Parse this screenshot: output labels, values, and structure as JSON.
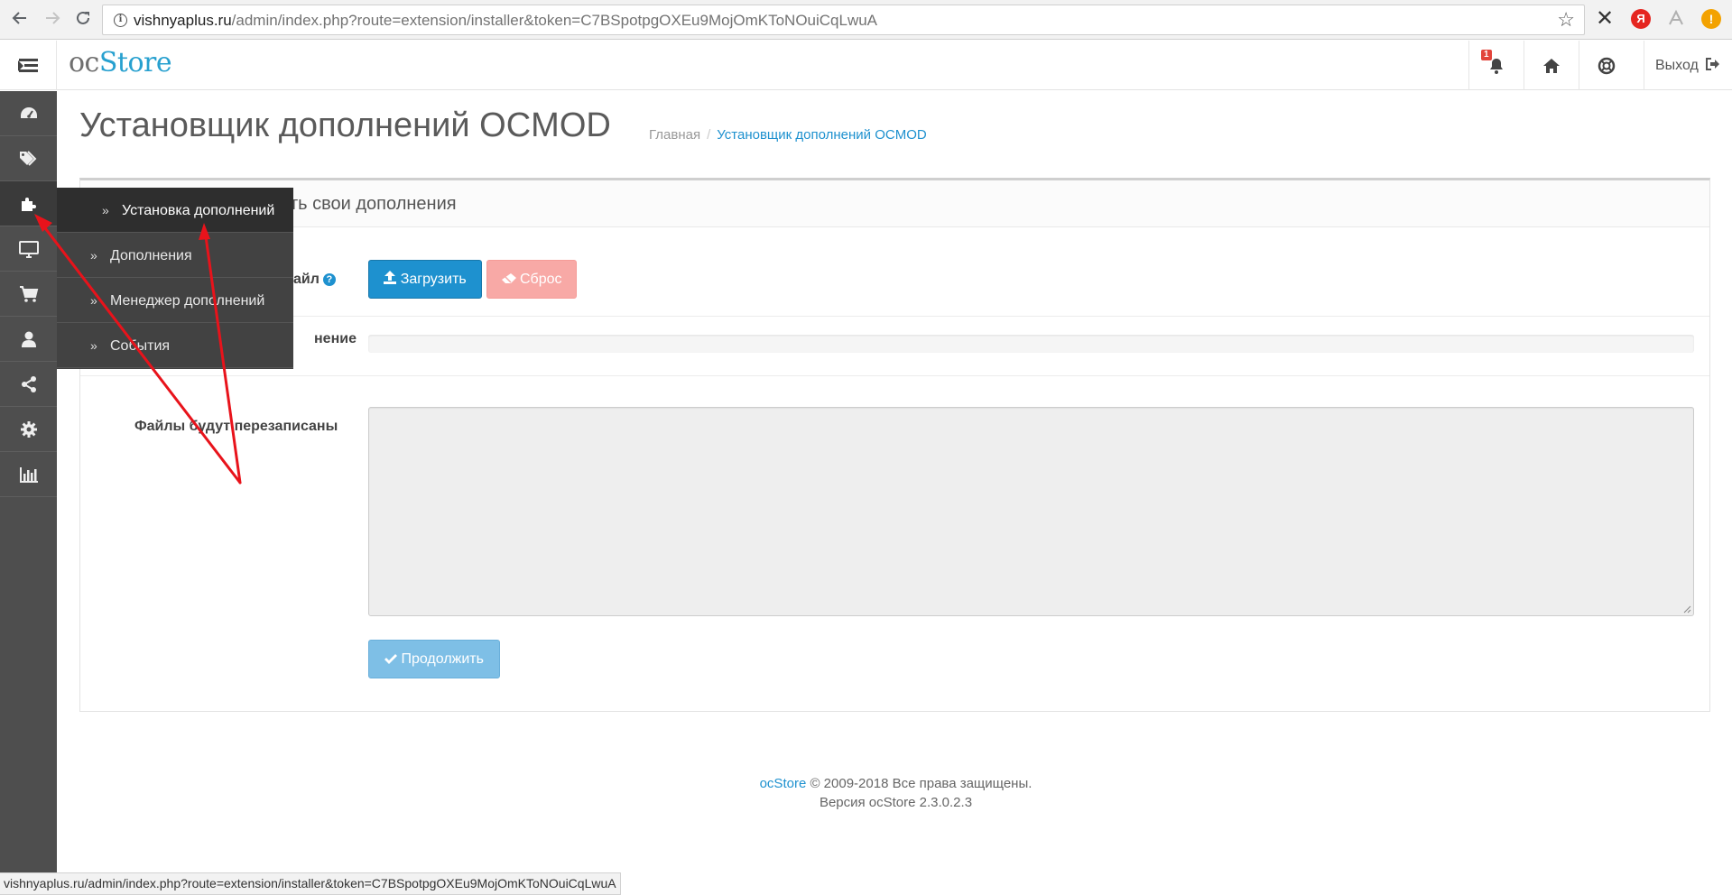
{
  "browser": {
    "url_host": "vishnyaplus.ru",
    "url_path": "/admin/index.php?route=extension/installer&token=C7BSpotpgOXEu9MojOmKToNOuiCqLwuA",
    "back_icon": "arrow-left-icon",
    "forward_icon": "arrow-right-icon",
    "reload_icon": "reload-icon",
    "extensions": [
      {
        "name": "x-extension-icon",
        "glyph": "X",
        "color": "#333333"
      },
      {
        "name": "yandex-icon",
        "glyph": "Я",
        "color": "#e52620"
      },
      {
        "name": "pdf-icon",
        "glyph": "⅄",
        "color": "#a8a8a8"
      },
      {
        "name": "warning-icon",
        "glyph": "!",
        "color": "#f3a200"
      }
    ]
  },
  "header": {
    "logo_oc": "oc",
    "logo_store": "Store",
    "notification_count": "1",
    "logout_label": "Выход"
  },
  "sidebar": {
    "icons": [
      "dashboard-icon",
      "tags-icon",
      "puzzle-icon",
      "desktop-icon",
      "cart-icon",
      "user-icon",
      "share-icon",
      "gear-icon",
      "bar-chart-icon"
    ],
    "active_index": 2,
    "submenu": [
      {
        "label": "Установка дополнений",
        "active": true
      },
      {
        "label": "Дополнения",
        "active": false
      },
      {
        "label": "Менеджер дополнений",
        "active": false
      },
      {
        "label": "События",
        "active": false
      }
    ]
  },
  "page": {
    "title": "Установщик дополнений OCMOD",
    "breadcrumb_home": "Главная",
    "breadcrumb_current": "Установщик дополнений OCMOD",
    "panel_title": "ть свои дополнения",
    "upload_label_visible": "айл",
    "upload_button": "Загрузить",
    "reset_button": "Сброс",
    "progress_label_visible": "нение",
    "overwrite_label": "Файлы будут перезаписаны",
    "continue_button": "Продолжить",
    "progress": 0
  },
  "footer": {
    "brand": "ocStore",
    "copyright": " © 2009-2018 Все права защищены.",
    "version": "Версия ocStore 2.3.0.2.3"
  },
  "status_bar": {
    "url": "vishnyaplus.ru/admin/index.php?route=extension/installer&token=C7BSpotpgOXEu9MojOmKToNOuiCqLwuA"
  },
  "colors": {
    "accent": "#1e91cf",
    "danger_light": "#f8a9a6",
    "sidebar": "#4e4e4e",
    "annotation_arrow": "#e8131b"
  }
}
